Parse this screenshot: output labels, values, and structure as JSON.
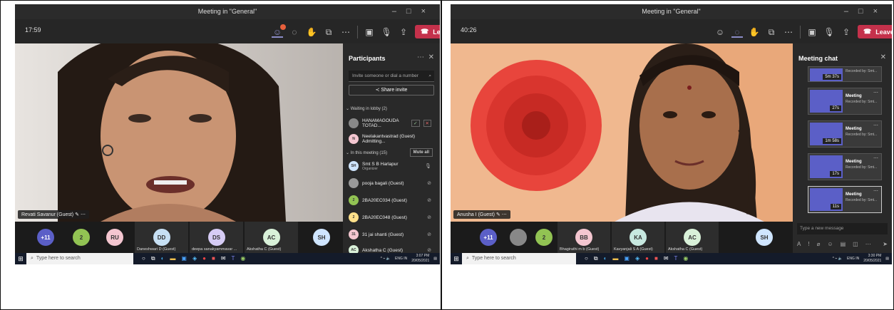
{
  "left": {
    "title": "Meeting in \"General\"",
    "timer": "17:59",
    "leave_label": "Leave",
    "video_name": "Revati Savanur (Guest)",
    "bottom_tiles": [
      {
        "initials": "+11",
        "color": "#5b5fc7",
        "label": ""
      },
      {
        "initials": "2",
        "color": "#92c353",
        "label": ""
      },
      {
        "initials": "RU",
        "color": "#f4c6d0",
        "label": ""
      },
      {
        "initials": "DD",
        "color": "#c7e0f4",
        "label": "Daneshwari D (Guest)"
      },
      {
        "initials": "DS",
        "color": "#d6ccf5",
        "label": "deepa sanakyammavar ..."
      },
      {
        "initials": "AC",
        "color": "#d9f1d9",
        "label": "Akshatha C (Guest)"
      },
      {
        "initials": "SH",
        "color": "#cfe5ff",
        "label": ""
      }
    ],
    "panel": {
      "title": "Participants",
      "invite_placeholder": "Invite someone or dial a number",
      "share_invite": "Share invite",
      "lobby_header": "Waiting in lobby (2)",
      "lobby": [
        "HANAMAGOUDA TOTAD...",
        "Neelakantvastrad (Guest) Admitting..."
      ],
      "meeting_header": "In this meeting (15)",
      "mute_all": "Mute all",
      "participants": [
        {
          "initials": "SH",
          "name": "Smt S B Harlapur",
          "sub": "Organizer",
          "color": "#cfe5ff"
        },
        {
          "initials": "",
          "name": "pooja bagali (Guest)",
          "sub": "",
          "color": "#999"
        },
        {
          "initials": "2",
          "name": "2BA20EC034 (Guest)",
          "sub": "",
          "color": "#92c353"
        },
        {
          "initials": "2",
          "name": "2BA20EC048 (Guest)",
          "sub": "",
          "color": "#ffe08a"
        },
        {
          "initials": "31",
          "name": "31 jai shanti (Guest)",
          "sub": "",
          "color": "#f4c6d0"
        },
        {
          "initials": "AC",
          "name": "Akshatha C (Guest)",
          "sub": "",
          "color": "#d9f1d9"
        }
      ],
      "lobby_initials": [
        "",
        "N"
      ]
    },
    "taskbar": {
      "search": "Type here to search",
      "lang": "ENG IN",
      "time": "3:07 PM",
      "date": "20/05/2021"
    }
  },
  "right": {
    "title": "Meeting in \"General\"",
    "timer": "40:26",
    "leave_label": "Leave",
    "video_name": "Anusha I (Guest)",
    "bottom_tiles": [
      {
        "initials": "+11",
        "color": "#5b5fc7",
        "label": ""
      },
      {
        "initials": "",
        "color": "#888",
        "label": ""
      },
      {
        "initials": "2",
        "color": "#92c353",
        "label": ""
      },
      {
        "initials": "BB",
        "color": "#f4c6d0",
        "label": "Bhagirathi m b (Guest)"
      },
      {
        "initials": "KA",
        "color": "#c7e8e0",
        "label": "Kavyanjali S A (Guest)"
      },
      {
        "initials": "AC",
        "color": "#d9f1d9",
        "label": "Akshatha C (Guest)"
      },
      {
        "initials": "SH",
        "color": "#cfe5ff",
        "label": ""
      }
    ],
    "chat": {
      "title": "Meeting chat",
      "cards": [
        {
          "duration": "5m 37s",
          "title": "",
          "sub": "Recorded by: Smt..."
        },
        {
          "duration": "27s",
          "title": "Meeting",
          "sub": "Recorded by: Smt..."
        },
        {
          "duration": "1m 58s",
          "title": "Meeting",
          "sub": "Recorded by: Smt..."
        },
        {
          "duration": "17s",
          "title": "Meeting",
          "sub": "Recorded by: Smt..."
        },
        {
          "duration": "11s",
          "title": "Meeting",
          "sub": "Recorded by: Smt..."
        }
      ],
      "placeholder": "Type a new message"
    },
    "taskbar": {
      "search": "Type here to search",
      "lang": "ENG IN",
      "time": "3:30 PM",
      "date": "20/05/2021"
    }
  }
}
